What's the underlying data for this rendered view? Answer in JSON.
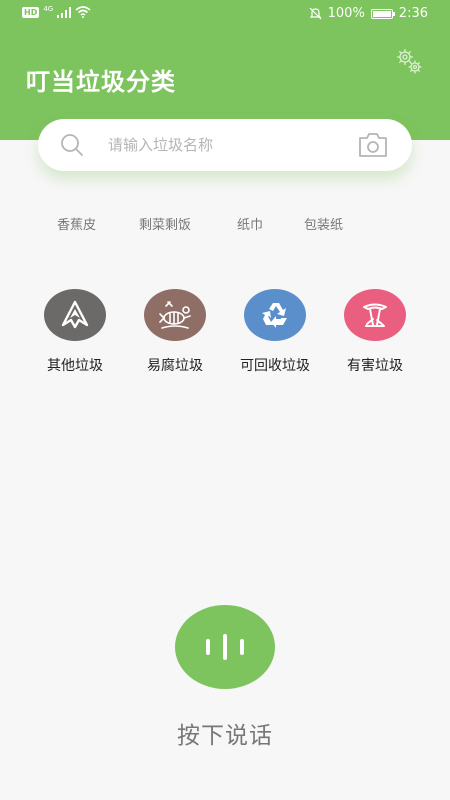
{
  "status_bar": {
    "hd": "HD",
    "network": "4G",
    "battery": "100%",
    "battery_level": 1.0,
    "time": "2:36"
  },
  "header": {
    "title": "叮当垃圾分类",
    "settings_icon": "gear-icon"
  },
  "search": {
    "placeholder": "请输入垃圾名称",
    "value": "",
    "search_icon": "search-icon",
    "camera_icon": "camera-icon"
  },
  "hot_words": [
    {
      "label": "香蕉皮"
    },
    {
      "label": "剩菜剩饭"
    },
    {
      "label": "纸巾"
    },
    {
      "label": "包装纸"
    }
  ],
  "categories": [
    {
      "label": "其他垃圾",
      "color": "#6b6a68",
      "icon": "other-waste-icon"
    },
    {
      "label": "易腐垃圾",
      "color": "#8f6e66",
      "icon": "food-waste-icon"
    },
    {
      "label": "可回收垃圾",
      "color": "#5b8fcc",
      "icon": "recycle-icon"
    },
    {
      "label": "有害垃圾",
      "color": "#ea5f80",
      "icon": "hazardous-waste-icon"
    }
  ],
  "voice": {
    "label": "按下说话",
    "icon": "voice-icon"
  },
  "colors": {
    "brand_green": "#7dc35e",
    "background": "#f7f7f7"
  }
}
